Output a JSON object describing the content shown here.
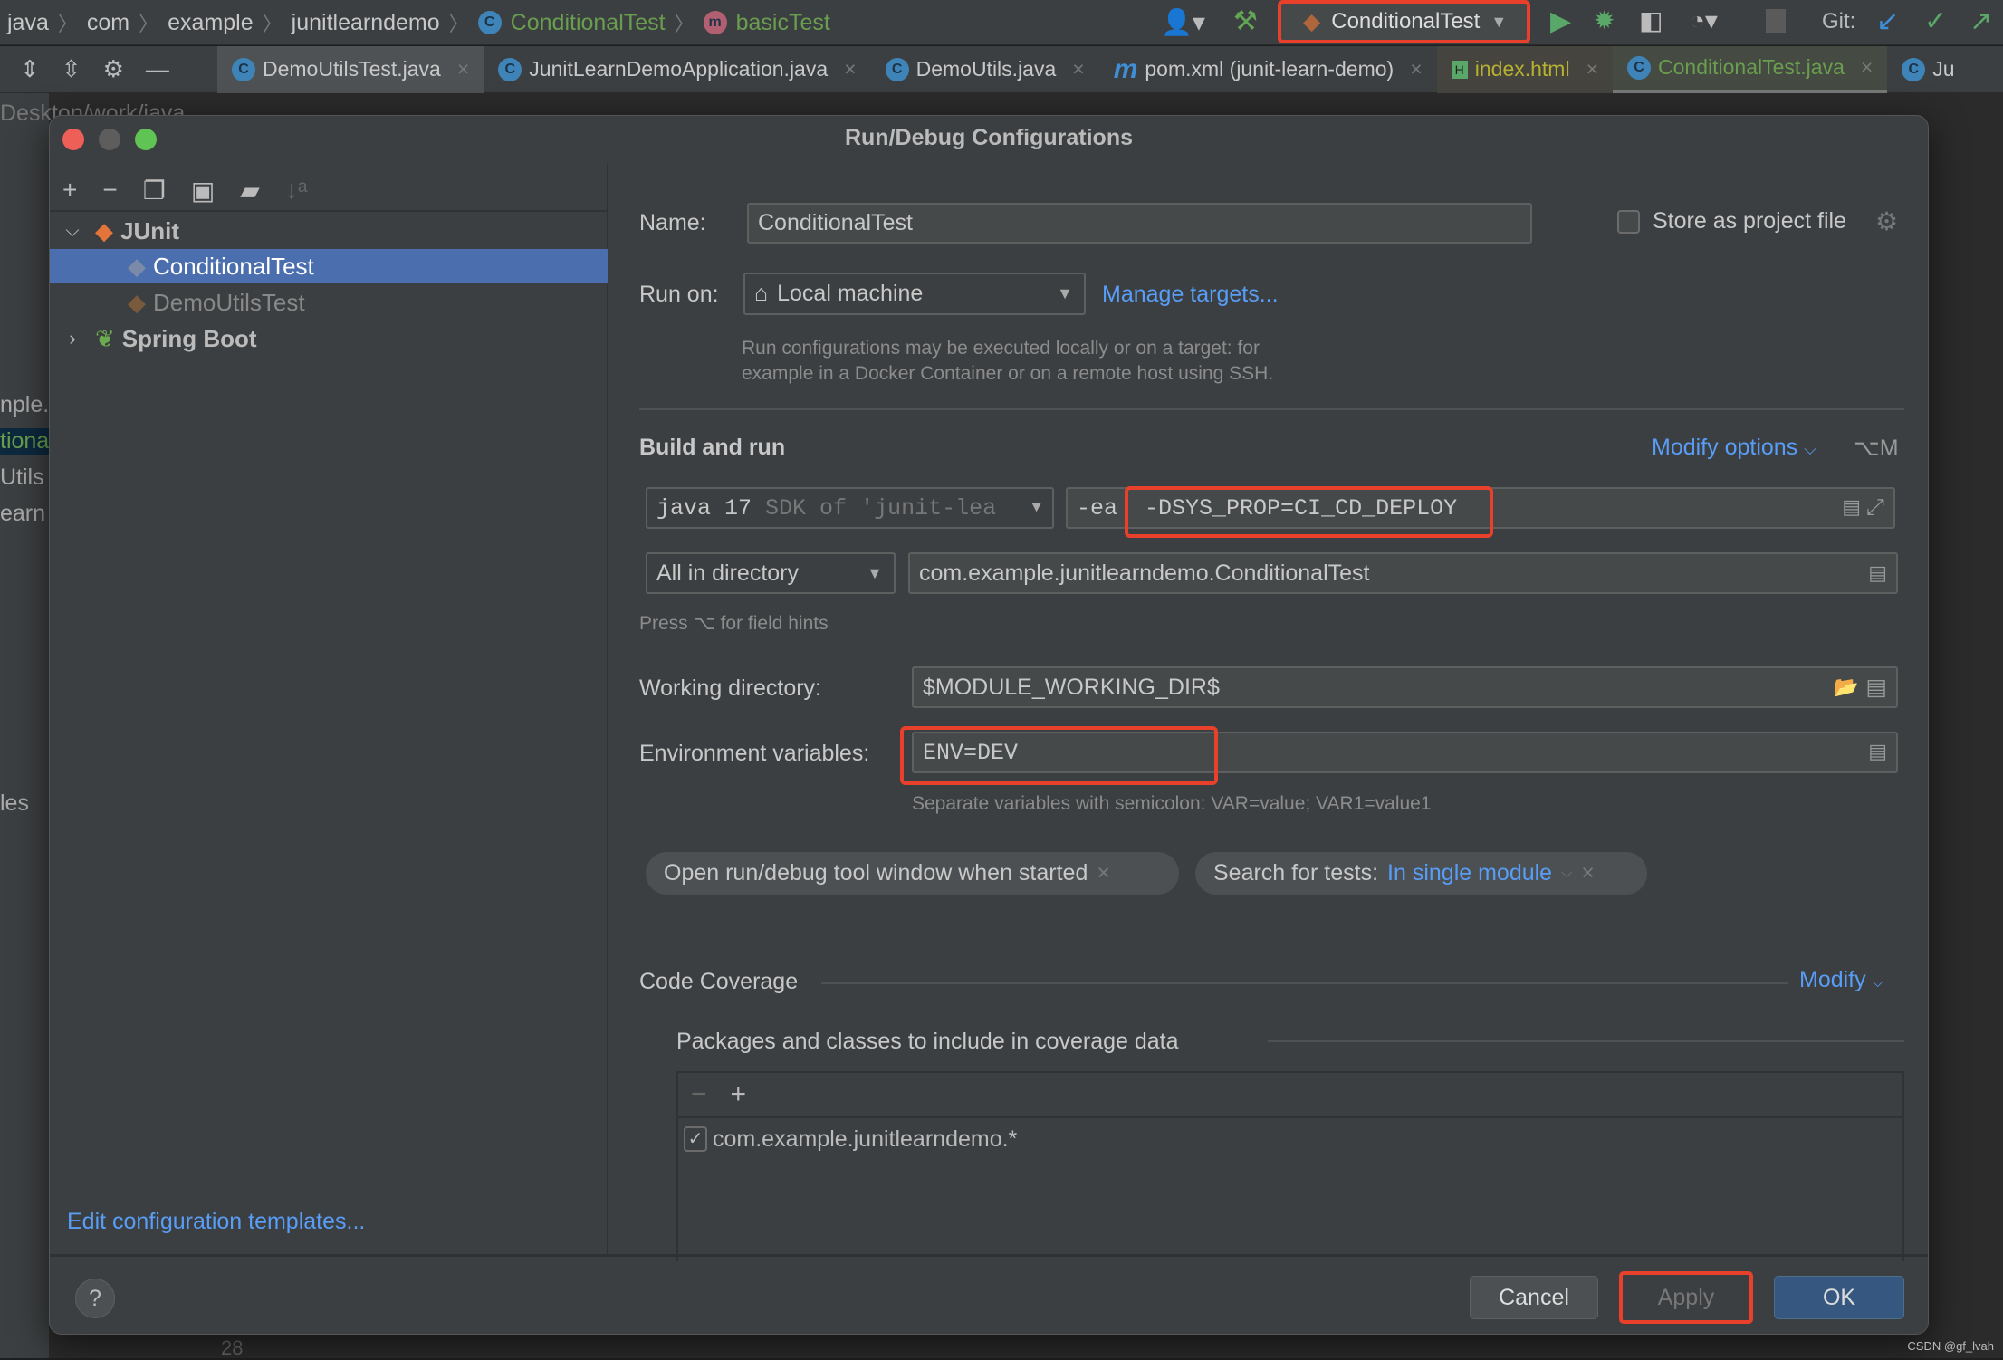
{
  "breadcrumb": [
    "java",
    "com",
    "example",
    "junitlearndemo",
    "ConditionalTest",
    "basicTest"
  ],
  "toolbar": {
    "run_config": "ConditionalTest",
    "git_label": "Git:"
  },
  "tabs": [
    {
      "label": "DemoUtilsTest.java",
      "icon": "class-icon"
    },
    {
      "label": "JunitLearnDemoApplication.java",
      "icon": "class-icon"
    },
    {
      "label": "DemoUtils.java",
      "icon": "class-icon"
    },
    {
      "label": "pom.xml (junit-learn-demo)",
      "icon": "maven-icon"
    },
    {
      "label": "index.html",
      "icon": "html-icon"
    },
    {
      "label": "ConditionalTest.java",
      "icon": "class-icon",
      "active": true
    },
    {
      "label": "Ju",
      "icon": "class-icon"
    }
  ],
  "background": {
    "path": "Desktop/work/java",
    "side": [
      "nple.",
      "tiona",
      "Utils",
      "earn",
      "les"
    ],
    "line": "28"
  },
  "dialog": {
    "title": "Run/Debug Configurations",
    "tree": {
      "group1": "JUnit",
      "item1": "ConditionalTest",
      "item2": "DemoUtilsTest",
      "group2": "Spring Boot"
    },
    "edit_templates": "Edit configuration templates...",
    "name_label": "Name:",
    "name_value": "ConditionalTest",
    "store_label": "Store as project file",
    "store_checked": false,
    "run_on_label": "Run on:",
    "run_on_value": "Local machine",
    "manage_targets": "Manage targets...",
    "run_on_help1": "Run configurations may be executed locally or on a target: for",
    "run_on_help2": "example in a Docker Container or on a remote host using SSH.",
    "build_run": "Build and run",
    "modify_options": "Modify options",
    "modify_shortcut": "⌥M",
    "jre_main": "java 17",
    "jre_sub": "SDK of 'junit-lea",
    "vm_prefix": "-ea",
    "vm_value": "-DSYS_PROP=CI_CD_DEPLOY",
    "test_kind": "All in directory",
    "test_class": "com.example.junitlearndemo.ConditionalTest",
    "field_hint": "Press ⌥ for field hints",
    "workdir_label": "Working directory:",
    "workdir_value": "$MODULE_WORKING_DIR$",
    "env_label": "Environment variables:",
    "env_value": "ENV=DEV",
    "env_hint": "Separate variables with semicolon: VAR=value; VAR1=value1",
    "chip1": "Open run/debug tool window when started",
    "chip2_label": "Search for tests:",
    "chip2_value": "In single module",
    "coverage": "Code Coverage",
    "coverage_modify": "Modify",
    "packages": "Packages and classes to include in coverage data",
    "package_item": "com.example.junitlearndemo.*",
    "package_checked": true,
    "cancel": "Cancel",
    "apply": "Apply",
    "ok": "OK",
    "help": "?"
  },
  "watermark": "CSDN @gf_lvah",
  "colors": {
    "accent": "#589df6",
    "selection": "#4b6eaf",
    "highlight": "#e8402b",
    "ok": "#365880"
  }
}
